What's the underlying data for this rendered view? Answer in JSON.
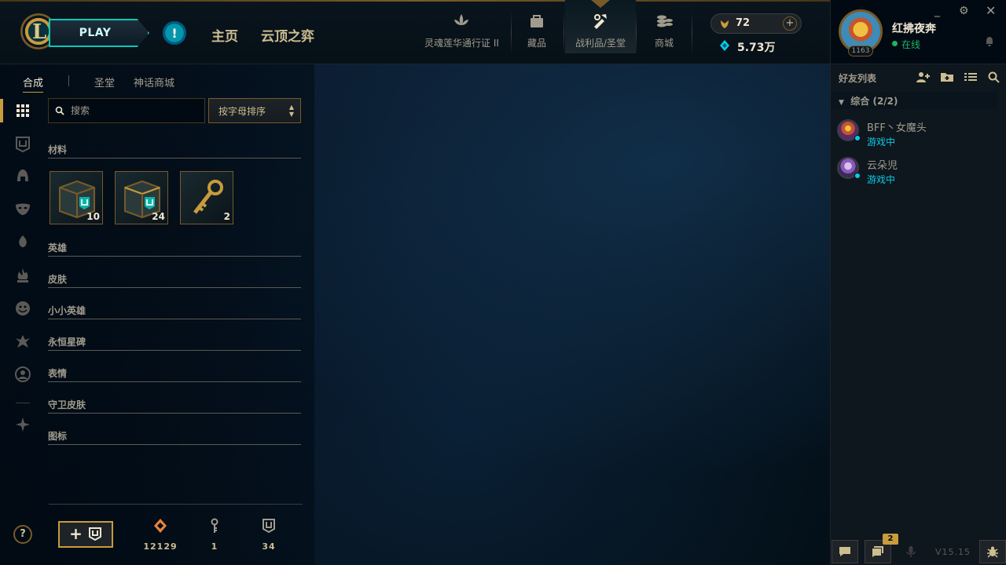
{
  "header": {
    "play_label": "PLAY",
    "alert_symbol": "!",
    "nav_home": "主页",
    "nav_tft": "云顶之弈",
    "icon_nav": [
      {
        "label": "灵魂莲华通行证 II",
        "icon": "lotus-icon"
      },
      {
        "label": "藏品",
        "icon": "collection-icon"
      },
      {
        "label": "战利品/圣堂",
        "icon": "loot-icon",
        "active": true
      },
      {
        "label": "商城",
        "icon": "store-icon"
      }
    ],
    "blue_essence": "72",
    "riot_points": "5.73万"
  },
  "subtabs": {
    "craft": "合成",
    "sanctum": "圣堂",
    "mythic_shop": "神话商城"
  },
  "search": {
    "placeholder": "搜索"
  },
  "sort": {
    "label": "按字母排序"
  },
  "categories": {
    "materials": "材料",
    "champions": "英雄",
    "skins": "皮肤",
    "tacticians": "小小英雄",
    "eternals": "永恒星碑",
    "emotes": "表情",
    "ward_skins": "守卫皮肤",
    "icons": "图标"
  },
  "loot_items": [
    {
      "name": "hextech-chest",
      "count": "10"
    },
    {
      "name": "masterwork-chest",
      "count": "24"
    },
    {
      "name": "hextech-key",
      "count": "2"
    }
  ],
  "bottom": {
    "craft_button": "+",
    "orange_essence": "12129",
    "keys": "1",
    "chests": "34"
  },
  "profile": {
    "name": "红拂夜奔",
    "status": "在线",
    "level": "1163"
  },
  "social": {
    "friends_title": "好友列表",
    "group_label": "综合 (2/2)",
    "friends": [
      {
        "name": "BFF丶女魔头",
        "status": "游戏中"
      },
      {
        "name": "云朵児",
        "status": "游戏中"
      }
    ],
    "notification_count": "2",
    "version": "V15.15"
  },
  "colors": {
    "gold": "#c89b3c",
    "teal": "#0ac8b9",
    "online_green": "#1eb464",
    "in_game_blue": "#0acbe6"
  }
}
